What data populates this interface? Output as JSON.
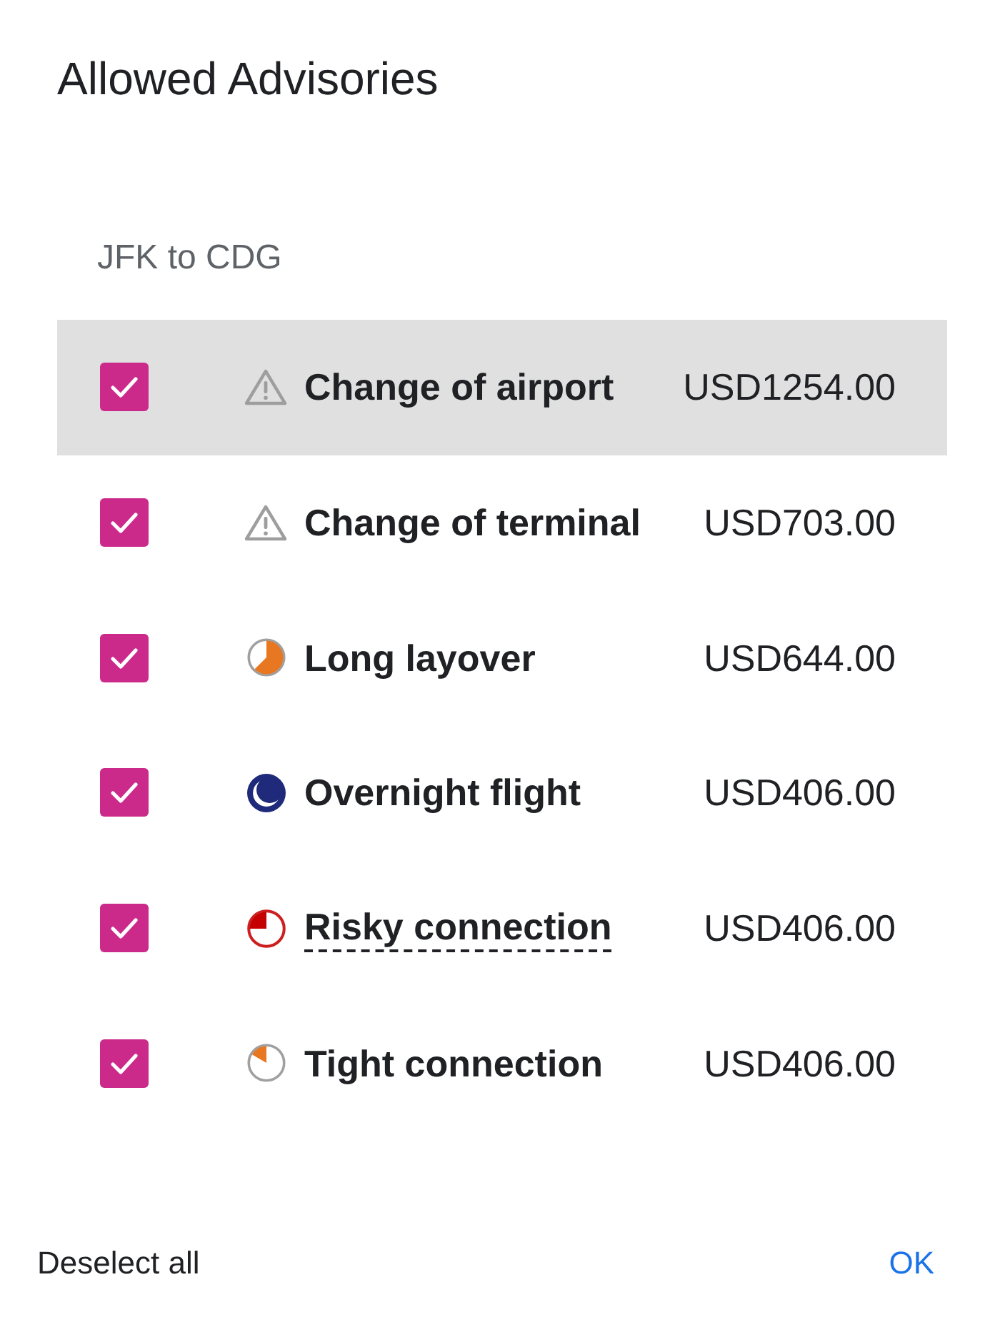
{
  "dialog": {
    "title": "Allowed Advisories"
  },
  "route": {
    "heading": "JFK to CDG"
  },
  "advisories": [
    {
      "kind": "warning",
      "label": "Change of airport",
      "price": "USD1254.00",
      "checked": true,
      "selected": true,
      "dotted_underline": false
    },
    {
      "kind": "warning",
      "label": "Change of terminal",
      "price": "USD703.00",
      "checked": true,
      "selected": false,
      "dotted_underline": false
    },
    {
      "kind": "layover",
      "label": "Long layover",
      "price": "USD644.00",
      "checked": true,
      "selected": false,
      "dotted_underline": false
    },
    {
      "kind": "overnight",
      "label": "Overnight flight",
      "price": "USD406.00",
      "checked": true,
      "selected": false,
      "dotted_underline": false
    },
    {
      "kind": "risky",
      "label": "Risky connection",
      "price": "USD406.00",
      "checked": true,
      "selected": false,
      "dotted_underline": true
    },
    {
      "kind": "tight",
      "label": "Tight connection",
      "price": "USD406.00",
      "checked": true,
      "selected": false,
      "dotted_underline": false
    }
  ],
  "footer": {
    "deselect_button": "Deselect all",
    "ok_button": "OK"
  }
}
